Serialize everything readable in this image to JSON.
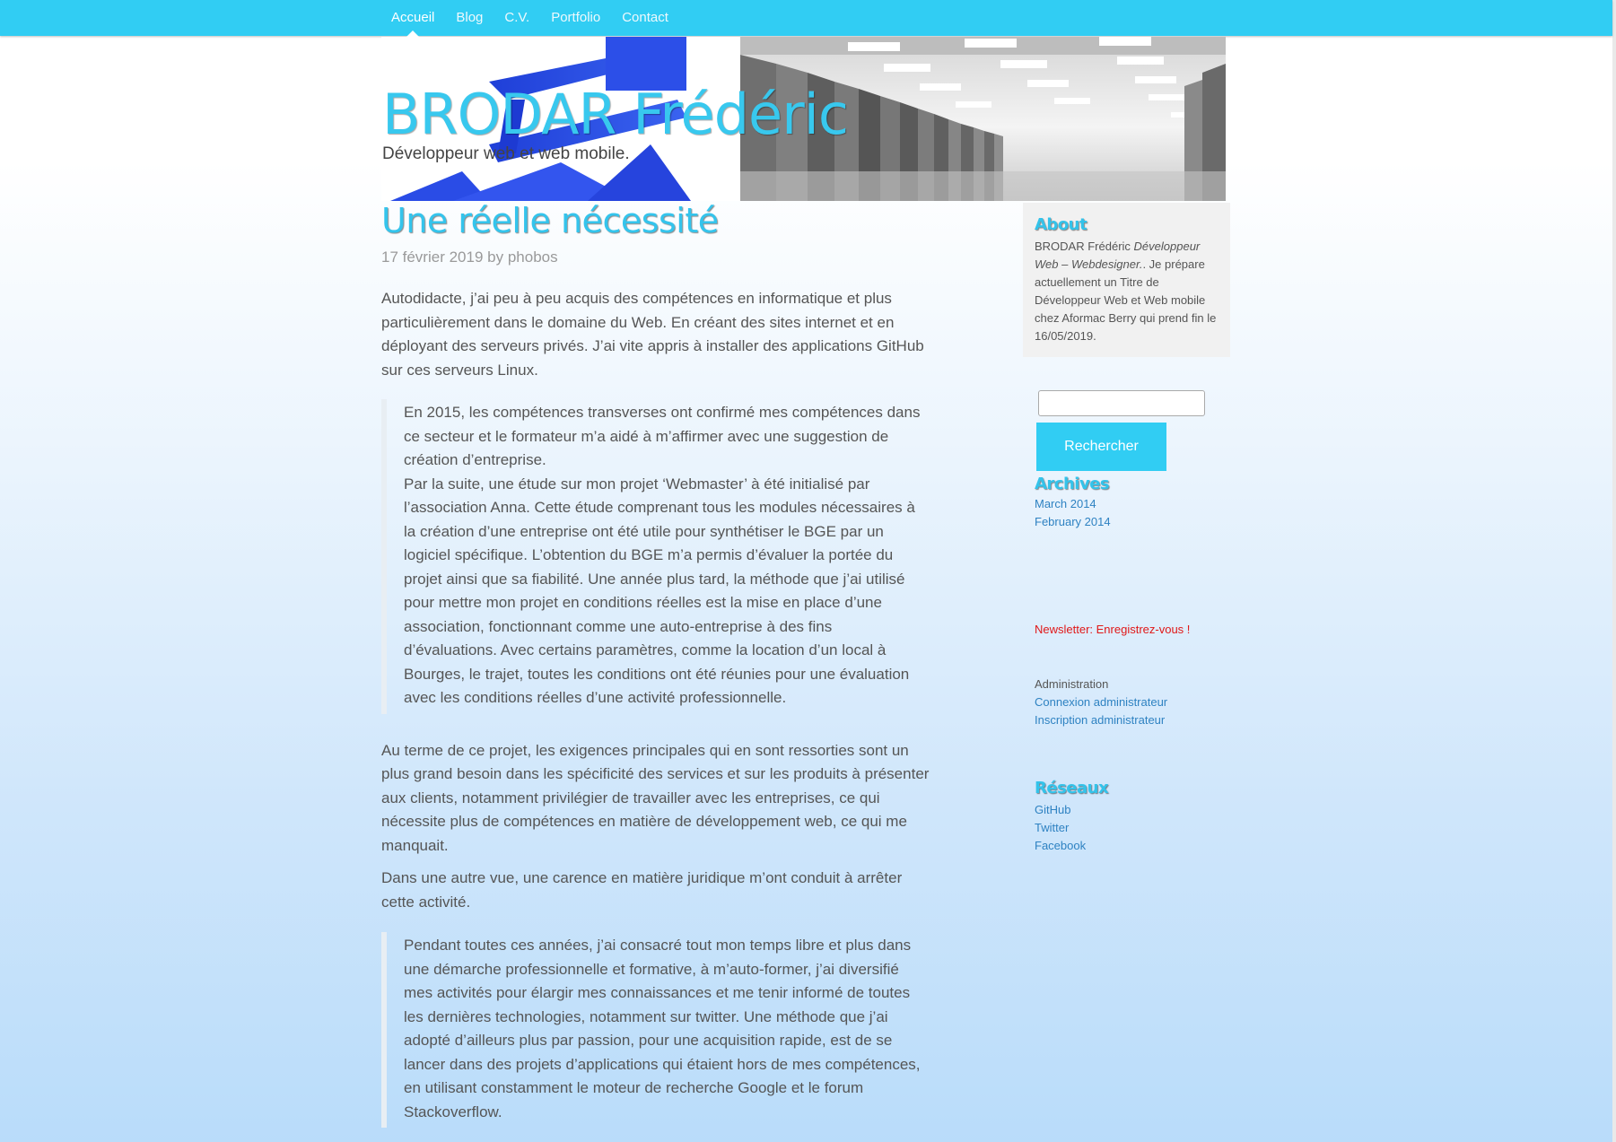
{
  "nav": {
    "items": [
      {
        "label": "Accueil",
        "active": true
      },
      {
        "label": "Blog"
      },
      {
        "label": "C.V."
      },
      {
        "label": "Portfolio"
      },
      {
        "label": "Contact"
      }
    ]
  },
  "header": {
    "title": "BRODAR Frédéric",
    "tagline": "Développeur web et web mobile."
  },
  "post": {
    "title": "Une réelle nécessité",
    "date": "17 février 2019",
    "by": "by",
    "author": "phobos",
    "p1": "Autodidacte, j’ai peu à peu acquis des compétences en informatique et plus particulièrement dans le domaine du Web. En créant des sites internet et en déployant des serveurs privés. J’ai vite appris à installer des applications GitHub sur ces serveurs Linux.",
    "quote1_a": "En 2015, les compétences transverses ont confirmé mes compétences dans ce secteur et le formateur m’a aidé à m’affirmer avec une suggestion de création d’entreprise.",
    "quote1_b": "Par la suite, une étude sur mon projet ‘Webmaster’ à été initialisé par l’association Anna. Cette étude comprenant tous les modules nécessaires à la création d’une entreprise ont été utile pour synthétiser le BGE par un logiciel spécifique. L’obtention du BGE m’a permis d’évaluer la portée du projet ainsi que sa fiabilité. Une année plus tard, la méthode que j’ai utilisé pour mettre mon projet en conditions réelles est la mise en place d’une association, fonctionnant comme une auto-entreprise à des fins d’évaluations. Avec certains paramètres, comme la location d’un local à Bourges, le trajet, toutes les conditions ont été réunies pour une évaluation avec les conditions réelles d’une activité professionnelle.",
    "p2": "Au terme de ce projet, les exigences principales qui en sont ressorties sont un plus grand besoin dans les spécificité des services et sur les produits à présenter aux clients, notamment privilégier de travailler avec les entreprises, ce qui nécessite plus de compétences en matière de développement web, ce qui me manquait.",
    "p3": "Dans une autre vue, une carence en matière juridique m’ont conduit à arrêter cette activité.",
    "quote2": "Pendant toutes ces années, j’ai consacré tout mon temps libre et plus dans une démarche professionnelle et formative, à m’auto-former, j’ai diversifié mes activités pour élargir mes connaissances et me tenir informé de toutes les dernières technologies, notamment sur twitter. Une méthode que j’ai adopté d’ailleurs plus par passion, pour une acquisition rapide, est de se lancer dans des projets d’applications qui étaient hors de mes compétences, en utilisant constamment le moteur de recherche Google et le forum Stackoverflow."
  },
  "sidebar": {
    "about": {
      "title": "About",
      "name": "BRODAR Frédéric",
      "role": "Développeur Web – Webdesigner.",
      "text": ". Je prépare actuellement un Titre de Développeur Web et Web mobile chez Aformac Berry qui prend fin le 16/05/2019."
    },
    "search": {
      "button": "Rechercher",
      "placeholder": ""
    },
    "archives": {
      "title": "Archives",
      "items": [
        "March 2014",
        "February 2014"
      ]
    },
    "newsletter": "Newsletter: Enregistrez-vous !",
    "admin": {
      "title": "Administration",
      "items": [
        "Connexion administrateur",
        "Inscription administrateur"
      ]
    },
    "reseaux": {
      "title": "Réseaux",
      "items": [
        "GitHub",
        "Twitter",
        "Facebook"
      ]
    }
  },
  "colors": {
    "nav": "#31cdf3",
    "accent": "#34c4ec",
    "link": "#2e82c2",
    "newsletter": "#e01818"
  }
}
